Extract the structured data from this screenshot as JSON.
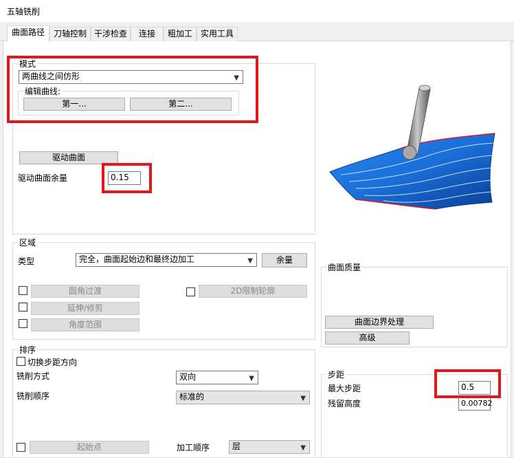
{
  "window": {
    "title": "五轴铣削"
  },
  "tabs": [
    "曲面路径",
    "刀轴控制",
    "干涉检查",
    "连接",
    "粗加工",
    "实用工具"
  ],
  "mode": {
    "label": "模式",
    "combo_value": "两曲线之间仿形",
    "edit_curves_label": "编辑曲线:",
    "first_button": "第一...",
    "second_button": "第二..."
  },
  "drive": {
    "surface_button": "驱动曲面",
    "allowance_label": "驱动曲面余量",
    "allowance_value": "0.15"
  },
  "region": {
    "label": "区域",
    "type_label": "类型",
    "type_value": "完全，曲面起始边和最终边加工",
    "allowance_button": "余量",
    "fillet_button": "圆角过渡",
    "extend_button": "延伸/修剪",
    "angle_button": "角度范围",
    "limit2d_button": "2D限制轮廓"
  },
  "quality": {
    "label": "曲面质量",
    "boundary_button": "曲面边界处理",
    "advanced_button": "高级"
  },
  "sorting": {
    "label": "排序",
    "switch_label": "切换步距方向",
    "mill_type_label": "铣削方式",
    "mill_type_value": "双向",
    "mill_order_label": "铣削顺序",
    "mill_order_value": "标准的",
    "start_point_button": "起始点",
    "machining_order_label": "加工顺序",
    "machining_order_value": "层"
  },
  "stepover": {
    "label": "步距",
    "max_label": "最大步距",
    "max_value": "0.5",
    "scallop_label": "残留高度",
    "scallop_value": "0.00782"
  },
  "colors": {
    "highlight": "#e4161c",
    "surface": "#1a6fd8",
    "surface_dark": "#0b3e99",
    "tool": "#8a8a8a"
  }
}
